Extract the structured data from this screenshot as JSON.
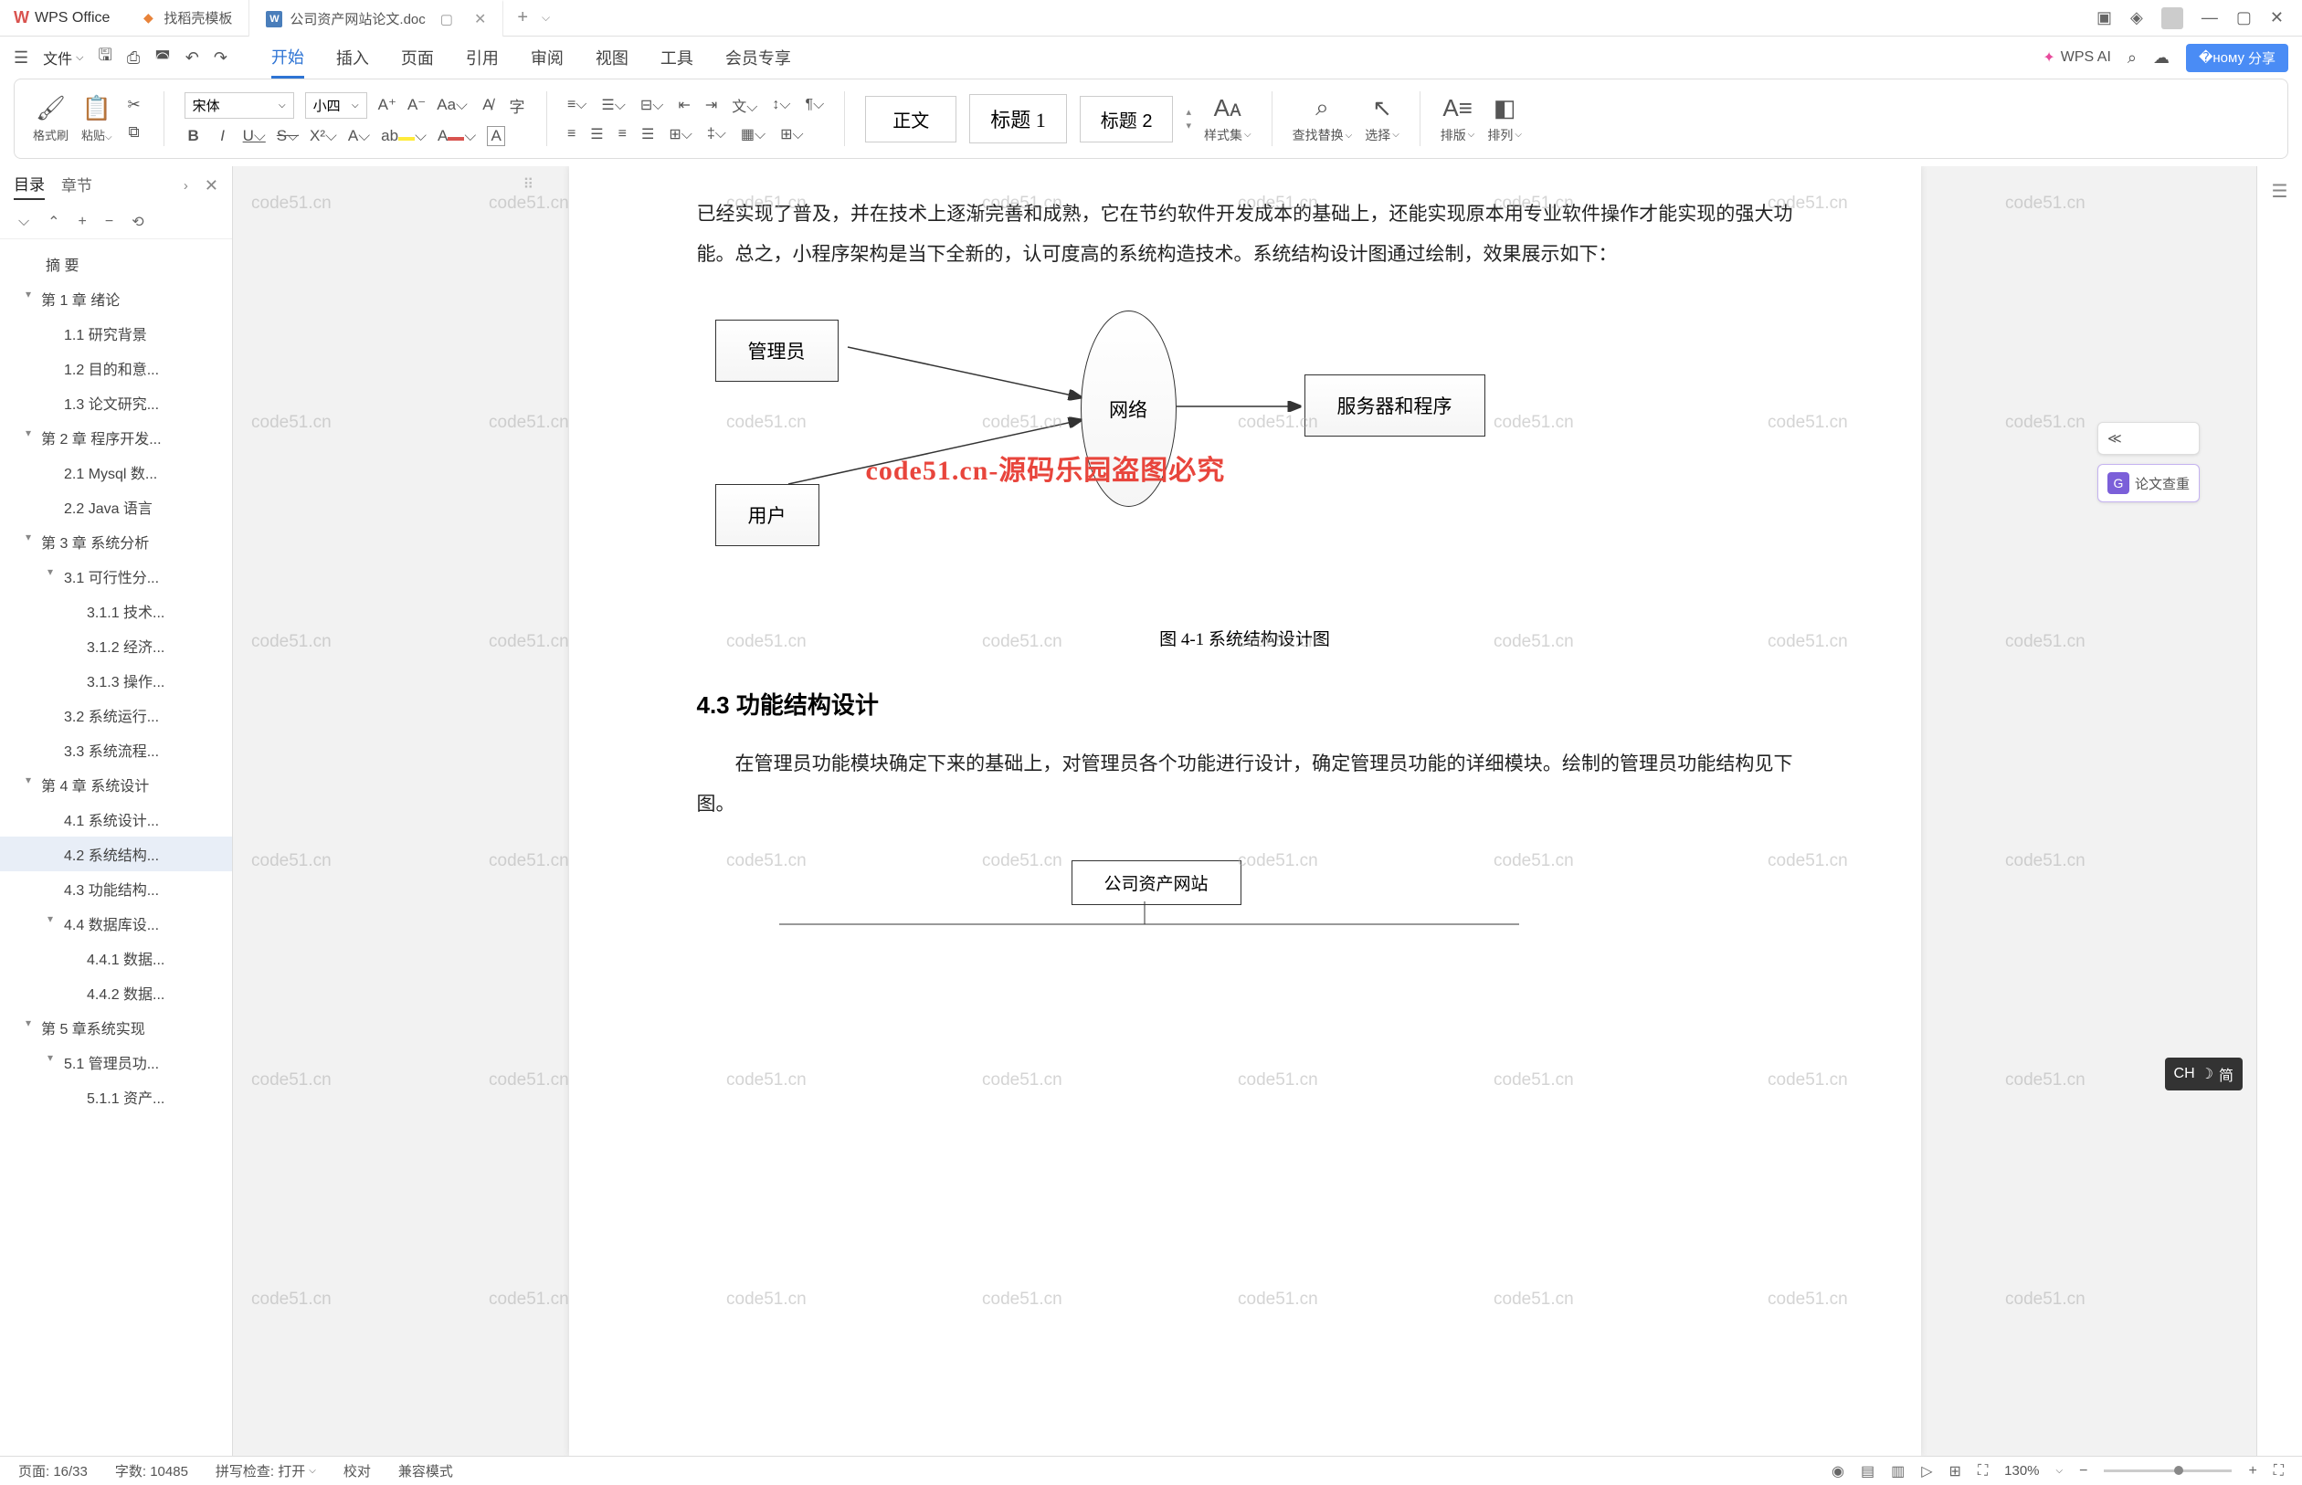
{
  "app": {
    "name": "WPS Office"
  },
  "tabs": [
    {
      "icon": "D",
      "label": "找稻壳模板"
    },
    {
      "icon": "W",
      "label": "公司资产网站论文.doc",
      "active": true
    }
  ],
  "titlebar": {
    "minimize": "—",
    "maximize": "▢",
    "close": "✕"
  },
  "menubar": {
    "file": "文件",
    "tabs": [
      "开始",
      "插入",
      "页面",
      "引用",
      "审阅",
      "视图",
      "工具",
      "会员专享"
    ],
    "active": "开始",
    "wps_ai": "WPS AI",
    "share": "分享"
  },
  "ribbon": {
    "format_painter": "格式刷",
    "paste": "粘贴",
    "font_name": "宋体",
    "font_size": "小四",
    "style_body": "正文",
    "style_h1": "标题 1",
    "style_h2": "标题 2",
    "styles": "样式集",
    "find": "查找替换",
    "select": "选择",
    "layout": "排版",
    "arrange": "排列"
  },
  "sidebar": {
    "tabs": [
      "目录",
      "章节"
    ],
    "items": [
      {
        "label": "摘  要",
        "level": 0
      },
      {
        "label": "第 1 章  绪论",
        "level": 1,
        "caret": true
      },
      {
        "label": "1.1  研究背景",
        "level": 2
      },
      {
        "label": "1.2 目的和意...",
        "level": 2
      },
      {
        "label": "1.3  论文研究...",
        "level": 2
      },
      {
        "label": "第 2 章  程序开发...",
        "level": 1,
        "caret": true
      },
      {
        "label": "2.1  Mysql 数...",
        "level": 2
      },
      {
        "label": "2.2  Java 语言",
        "level": 2
      },
      {
        "label": "第 3 章  系统分析",
        "level": 1,
        "caret": true
      },
      {
        "label": "3.1  可行性分...",
        "level": 2,
        "caret": true
      },
      {
        "label": "3.1.1  技术...",
        "level": 3
      },
      {
        "label": "3.1.2  经济...",
        "level": 3
      },
      {
        "label": "3.1.3  操作...",
        "level": 3
      },
      {
        "label": "3.2  系统运行...",
        "level": 2
      },
      {
        "label": "3.3  系统流程...",
        "level": 2
      },
      {
        "label": "第 4 章  系统设计",
        "level": 1,
        "caret": true
      },
      {
        "label": "4.1  系统设计...",
        "level": 2
      },
      {
        "label": "4.2  系统结构...",
        "level": 2,
        "active": true
      },
      {
        "label": "4.3 功能结构...",
        "level": 2
      },
      {
        "label": "4.4 数据库设...",
        "level": 2,
        "caret": true
      },
      {
        "label": "4.4.1  数据...",
        "level": 3
      },
      {
        "label": "4.4.2  数据...",
        "level": 3
      },
      {
        "label": "第 5 章系统实现",
        "level": 1,
        "caret": true
      },
      {
        "label": "5.1  管理员功...",
        "level": 2,
        "caret": true
      },
      {
        "label": "5.1.1  资产...",
        "level": 3
      }
    ]
  },
  "document": {
    "para1": "已经实现了普及，并在技术上逐渐完善和成熟，它在节约软件开发成本的基础上，还能实现原本用专业软件操作才能实现的强大功能。总之，小程序架构是当下全新的，认可度高的系统构造技术。系统结构设计图通过绘制，效果展示如下：",
    "diagram": {
      "admin": "管理员",
      "user": "用户",
      "network": "网络",
      "server": "服务器和程序"
    },
    "caption": "图 4-1  系统结构设计图",
    "heading": "4.3 功能结构设计",
    "para2": "在管理员功能模块确定下来的基础上，对管理员各个功能进行设计，确定管理员功能的详细模块。绘制的管理员功能结构见下图。",
    "flowchart_root": "公司资产网站",
    "watermark_center": "code51.cn-源码乐园盗图必究",
    "watermark_text": "code51.cn"
  },
  "right_float": {
    "collapse": "≪",
    "check": "论文查重"
  },
  "ime": {
    "lang": "CH",
    "mode": "简"
  },
  "statusbar": {
    "page": "页面: 16/33",
    "words": "字数: 10485",
    "spell": "拼写检查: 打开",
    "proof": "校对",
    "compat": "兼容模式",
    "zoom": "130%"
  }
}
